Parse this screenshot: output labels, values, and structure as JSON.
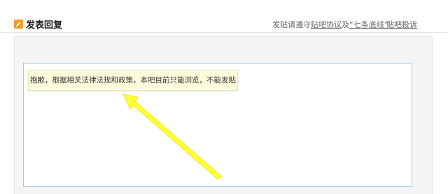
{
  "header": {
    "title": "发表回复",
    "rules_prefix": "发贴请遵守",
    "rules_link1": "贴吧协议",
    "rules_and": "及",
    "rules_link2": "“七条底线”",
    "complain_link": "贴吧投诉"
  },
  "editor": {
    "notice": "抱歉，根据相关法律法规和政策，本吧目前只能浏览，不能发贴"
  },
  "colors": {
    "accent_orange": "#f39a2b",
    "editor_border": "#9ec6e8",
    "notice_bg": "#fcfcdd",
    "arrow_yellow": "#ffff33"
  },
  "icons": {
    "title_icon": "edit-icon",
    "annotation": "arrow-annotation"
  }
}
